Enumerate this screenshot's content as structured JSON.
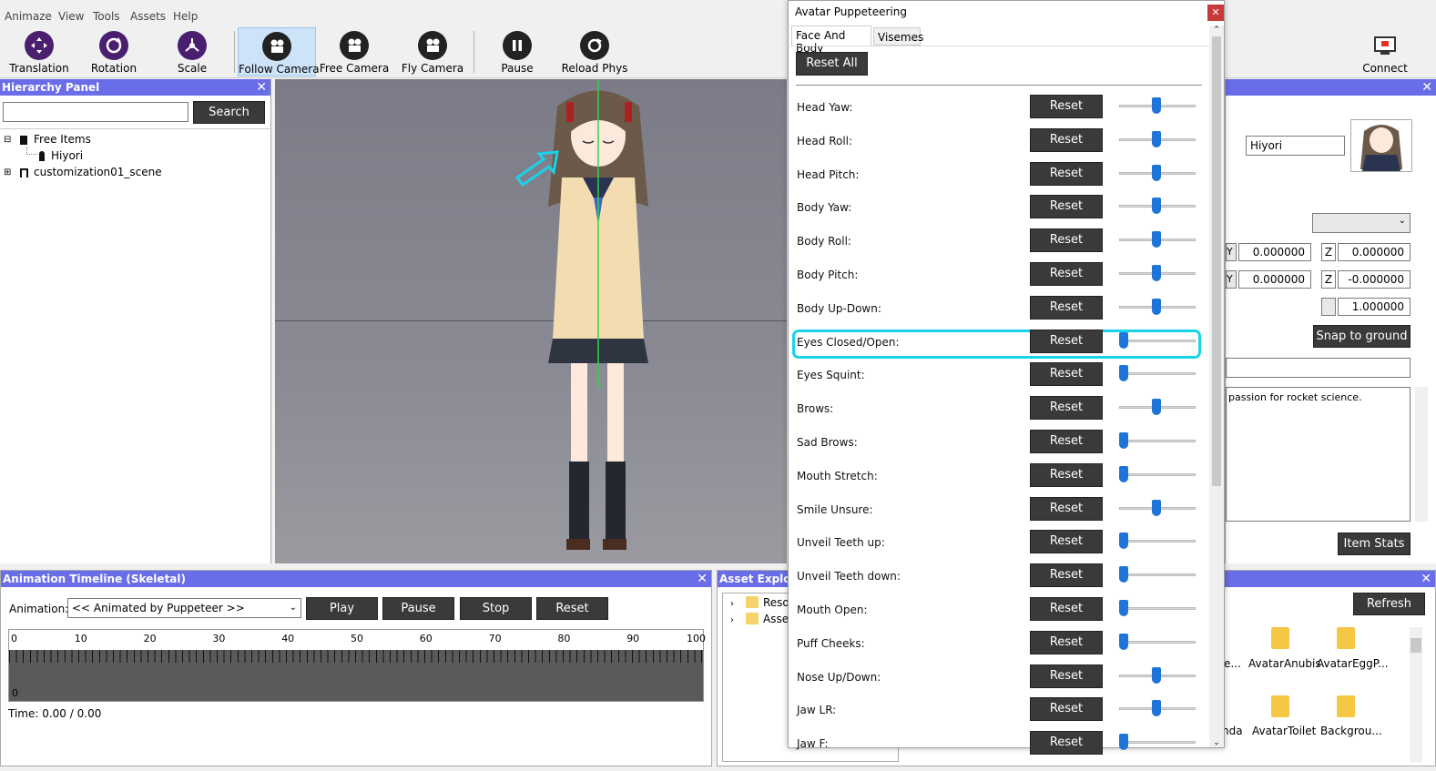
{
  "menu": [
    "Animaze",
    "View",
    "Tools",
    "Assets",
    "Help"
  ],
  "toolbar": {
    "translation": "Translation",
    "rotation": "Rotation",
    "scale": "Scale",
    "follow_camera": "Follow Camera",
    "free_camera": "Free Camera",
    "fly_camera": "Fly Camera",
    "pause": "Pause",
    "reload_phys": "Reload Phys",
    "connect": "Connect"
  },
  "hierarchy": {
    "title": "Hierarchy Panel",
    "search_value": "",
    "search_button": "Search",
    "tree": {
      "free_items": "Free Items",
      "hiyori": "Hiyori",
      "scene": "customization01_scene"
    }
  },
  "timeline": {
    "title": "Animation Timeline (Skeletal)",
    "animation_label": "Animation:",
    "animation_value": "<< Animated by Puppeteer >>",
    "play": "Play",
    "pause": "Pause",
    "stop": "Stop",
    "reset": "Reset",
    "ticks": [
      "0",
      "10",
      "20",
      "30",
      "40",
      "50",
      "60",
      "70",
      "80",
      "90",
      "100"
    ],
    "track_start": "0",
    "time": "Time: 0.00 / 0.00"
  },
  "asset_explorer": {
    "title": "Asset Explore",
    "tree": [
      "Resou",
      "Asset"
    ],
    "refresh": "Refresh",
    "items": [
      "e...",
      "AvatarAnubis",
      "AvatarEggP...",
      "nda",
      "AvatarToilet",
      "Backgrou..."
    ]
  },
  "properties": {
    "name_value": "Hiyori",
    "y1_label": "Y",
    "y1_value": "0.000000",
    "z1_label": "Z",
    "z1_value": "0.000000",
    "y2_label": "Y",
    "y2_value": "0.000000",
    "z2_label": "Z",
    "z2_value": "-0.000000",
    "scale_value": "1.000000",
    "snap_button": "Snap to ground",
    "description": "passion for rocket science.",
    "item_stats": "Item Stats"
  },
  "dialog": {
    "title": "Avatar Puppeteering",
    "tabs": [
      "Face And Body",
      "Visemes"
    ],
    "reset_all": "Reset All",
    "reset_label": "Reset",
    "sliders": [
      {
        "label": "Head Yaw:",
        "value": 0.5
      },
      {
        "label": "Head Roll:",
        "value": 0.5
      },
      {
        "label": "Head Pitch:",
        "value": 0.5
      },
      {
        "label": "Body Yaw:",
        "value": 0.5
      },
      {
        "label": "Body Roll:",
        "value": 0.5
      },
      {
        "label": "Body Pitch:",
        "value": 0.5
      },
      {
        "label": "Body Up-Down:",
        "value": 0.5
      },
      {
        "label": "Eyes Closed/Open:",
        "value": 0.0,
        "highlighted": true
      },
      {
        "label": "Eyes Squint:",
        "value": 0.0
      },
      {
        "label": "Brows:",
        "value": 0.5
      },
      {
        "label": "Sad Brows:",
        "value": 0.0
      },
      {
        "label": "Mouth Stretch:",
        "value": 0.0
      },
      {
        "label": "Smile Unsure:",
        "value": 0.5
      },
      {
        "label": "Unveil Teeth up:",
        "value": 0.0
      },
      {
        "label": "Unveil Teeth down:",
        "value": 0.0
      },
      {
        "label": "Mouth Open:",
        "value": 0.0
      },
      {
        "label": "Puff Cheeks:",
        "value": 0.0
      },
      {
        "label": "Nose Up/Down:",
        "value": 0.5
      },
      {
        "label": "Jaw LR:",
        "value": 0.5
      },
      {
        "label": "Jaw F:",
        "value": 0.0
      }
    ]
  },
  "colors": {
    "panel_header": "#6a6de8",
    "highlight": "#19d3e8",
    "slider": "#1f74d8",
    "accent_icon": "#4a1f70"
  }
}
